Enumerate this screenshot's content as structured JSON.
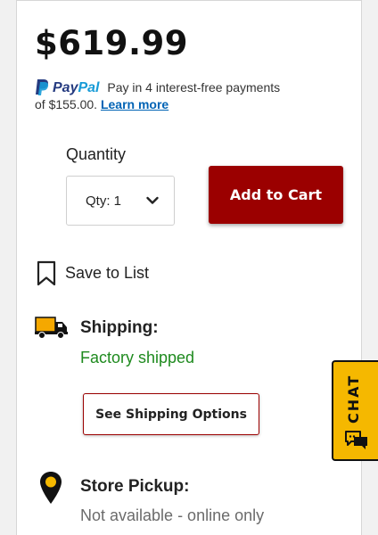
{
  "product": {
    "price": "$619.99"
  },
  "paypal": {
    "brand_pay": "Pay",
    "brand_pal": "Pal",
    "text_line1": "Pay in 4 interest-free payments",
    "text_line2": "of $155.00.",
    "learn_more": "Learn more"
  },
  "quantity": {
    "label": "Quantity",
    "selected": "Qty: 1"
  },
  "actions": {
    "add_to_cart": "Add to Cart",
    "save_to_list": "Save to List"
  },
  "shipping": {
    "title": "Shipping:",
    "status": "Factory shipped",
    "options_button": "See Shipping Options"
  },
  "pickup": {
    "title": "Store Pickup:",
    "status": "Not available - online only"
  },
  "chat": {
    "label": "CHAT"
  },
  "colors": {
    "cart_button": "#9b0000",
    "shipping_status": "#1e8a1e",
    "chat_tab": "#f5b800",
    "link": "#0063b5"
  }
}
